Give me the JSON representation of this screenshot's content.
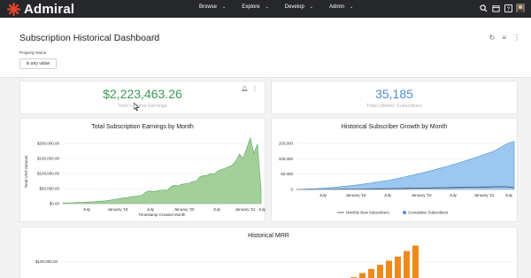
{
  "app": {
    "name": "Admiral"
  },
  "nav": [
    {
      "label": "Browse"
    },
    {
      "label": "Explore"
    },
    {
      "label": "Develop"
    },
    {
      "label": "Admin"
    }
  ],
  "dashboard": {
    "title": "Subscription Historical Dashboard",
    "filter_label": "Property Name",
    "filter_value": "is any value"
  },
  "kpis": [
    {
      "value": "$2,223,463.26",
      "caption": "Total Lifetime Earnings",
      "color": "#3a9b52"
    },
    {
      "value": "35,185",
      "caption": "Total Lifetime Subscribers",
      "color": "#4d8fd1"
    }
  ],
  "colors": {
    "green": "#a3d09a",
    "green_line": "#56a45a",
    "blue": "#9cc7ef",
    "blue_line": "#4a8fd6",
    "orange": "#ee8a1c",
    "topbar": "#26272b"
  },
  "chart_data": [
    {
      "type": "area",
      "title": "Total Subscription Earnings by Month",
      "xlabel": "Timestamp Created Month",
      "ylabel": "Total USD Amount",
      "x_tick_labels": [
        "July",
        "January '19",
        "July",
        "January '20",
        "July",
        "January '21",
        "July"
      ],
      "y_tick_labels": [
        "$200,000.00",
        "$150,000.00",
        "$100,000.00",
        "$50,000.00",
        "$0.00"
      ],
      "ylim": [
        0,
        225000
      ],
      "values": [
        2000,
        2500,
        3000,
        3500,
        4000,
        4500,
        5000,
        5500,
        6000,
        7000,
        8000,
        9000,
        10000,
        12000,
        14000,
        16000,
        18000,
        20000,
        22000,
        24000,
        26000,
        28000,
        30000,
        40000,
        45000,
        42000,
        45000,
        47000,
        48000,
        47000,
        60000,
        65000,
        62000,
        68000,
        70000,
        72000,
        78000,
        80000,
        95000,
        98000,
        100000,
        106000,
        104000,
        115000,
        120000,
        125000,
        130000,
        136000,
        150000,
        175000,
        160000,
        195000,
        232000,
        178000,
        210000,
        45000
      ]
    },
    {
      "type": "area",
      "title": "Historical Subscriber Growth by Month",
      "x_tick_labels": [
        "July",
        "January '19",
        "July",
        "January '20",
        "July",
        "January '21",
        "July"
      ],
      "y_tick_labels": [
        "150,000",
        "100,000",
        "50,000",
        "0"
      ],
      "ylim": [
        0,
        170000
      ],
      "series": [
        {
          "name": "Monthly New Subscribers",
          "values": [
            0,
            100,
            200,
            300,
            400,
            500,
            700,
            900,
            1100,
            1300,
            1500,
            1700,
            2000,
            2300,
            2600,
            3000,
            3400,
            3800,
            4200,
            4600,
            5000,
            5400,
            5800,
            6200,
            6600,
            7000,
            7400,
            7800,
            8200,
            8600,
            9000,
            9400,
            9000,
            6000
          ]
        },
        {
          "name": "Cumulative Subscribers",
          "values": [
            0,
            1000,
            2000,
            3000,
            4500,
            6000,
            8000,
            10000,
            12500,
            15000,
            18000,
            21000,
            24500,
            28000,
            32000,
            36500,
            41000,
            46000,
            51000,
            56500,
            62000,
            68000,
            74000,
            80500,
            87000,
            94000,
            101000,
            108500,
            116000,
            124000,
            132000,
            145000,
            158000,
            165000
          ]
        }
      ]
    },
    {
      "type": "bar",
      "title": "Historical MRR",
      "y_tick_labels": [
        "$100,000.00"
      ],
      "values": [
        15000,
        30000,
        45000,
        60000,
        75000,
        90000,
        105000,
        120000,
        140000,
        160000
      ]
    }
  ]
}
